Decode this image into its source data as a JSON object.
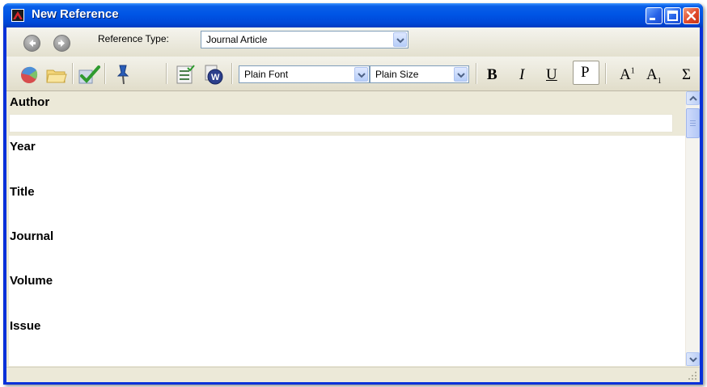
{
  "window": {
    "title": "New Reference",
    "title_bar_color": "#0055e5",
    "icons": [
      "minimize-icon",
      "maximize-icon",
      "close-icon"
    ]
  },
  "nav": {
    "back_icon": "back-arrow-icon",
    "forward_icon": "forward-arrow-icon"
  },
  "reference_type": {
    "label": "Reference Type:",
    "value": "Journal Article"
  },
  "toolbar": {
    "icons": [
      "insert-picture-icon",
      "open-folder-icon",
      "spell-check-icon",
      "pin-icon",
      "list-check-icon",
      "word-icon"
    ],
    "font_value": "Plain Font",
    "size_value": "Plain Size",
    "bold_label": "B",
    "italic_label": "I",
    "underline_label": "U",
    "plain_label": "P",
    "superscript_label": "A",
    "superscript_mark": "1",
    "subscript_label": "A",
    "subscript_mark": "1",
    "symbol_label": "Σ"
  },
  "fields": [
    "Author",
    "Year",
    "Title",
    "Journal",
    "Volume",
    "Issue"
  ],
  "field_values": {
    "author": "",
    "year": "",
    "title": "",
    "journal": "",
    "volume": "",
    "issue": ""
  }
}
